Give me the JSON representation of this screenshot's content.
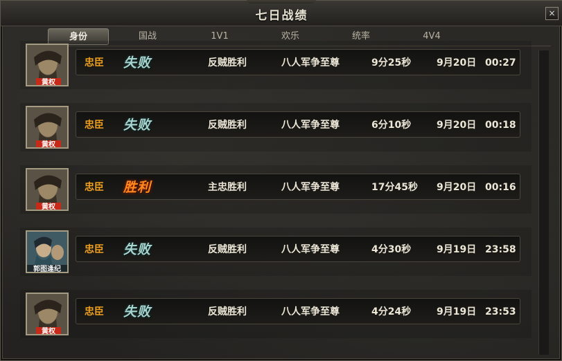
{
  "window": {
    "title": "七日战绩",
    "close": "×"
  },
  "tabs": [
    {
      "label": "身份",
      "active": true
    },
    {
      "label": "国战",
      "active": false
    },
    {
      "label": "1V1",
      "active": false
    },
    {
      "label": "欢乐",
      "active": false
    },
    {
      "label": "统率",
      "active": false
    },
    {
      "label": "4V4",
      "active": false
    }
  ],
  "rows": [
    {
      "avatar_name": "黄权",
      "role": "忠臣",
      "outcome": "失败",
      "side": "反贼胜利",
      "mode": "八人军争至尊",
      "duration": "9分25秒",
      "date": "9月20日",
      "time": "00:27"
    },
    {
      "avatar_name": "黄权",
      "role": "忠臣",
      "outcome": "失败",
      "side": "反贼胜利",
      "mode": "八人军争至尊",
      "duration": "6分10秒",
      "date": "9月20日",
      "time": "00:18"
    },
    {
      "avatar_name": "黄权",
      "role": "忠臣",
      "outcome": "胜利",
      "side": "主忠胜利",
      "mode": "八人军争至尊",
      "duration": "17分45秒",
      "date": "9月20日",
      "time": "00:16"
    },
    {
      "avatar_name": "郭图逢纪",
      "role": "忠臣",
      "outcome": "失败",
      "side": "反贼胜利",
      "mode": "八人军争至尊",
      "duration": "4分30秒",
      "date": "9月19日",
      "time": "23:58"
    },
    {
      "avatar_name": "黄权",
      "role": "忠臣",
      "outcome": "失败",
      "side": "反贼胜利",
      "mode": "八人军争至尊",
      "duration": "4分24秒",
      "date": "9月19日",
      "time": "23:53"
    }
  ],
  "colors": {
    "role": "#f0a020",
    "win": "#ff8a1e",
    "lose": "#a8d4cf",
    "text": "#ece6d6"
  }
}
